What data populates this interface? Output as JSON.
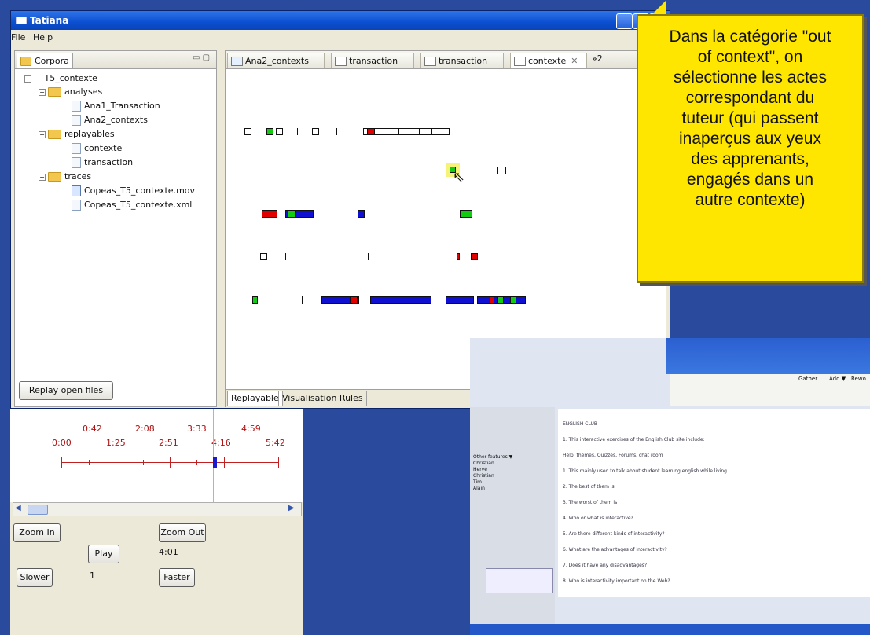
{
  "window": {
    "title": "Tatiana",
    "menu": [
      "File",
      "Help"
    ]
  },
  "left_panel": {
    "tab": "Corpora",
    "tree": {
      "root": "T5_contexte",
      "analyses": {
        "label": "analyses",
        "items": [
          "Ana1_Transaction",
          "Ana2_contexts"
        ]
      },
      "replayables": {
        "label": "replayables",
        "items": [
          "contexte",
          "transaction"
        ]
      },
      "traces": {
        "label": "traces",
        "items": [
          "Copeas_T5_contexte.mov",
          "Copeas_T5_contexte.xml"
        ]
      }
    },
    "replay_button": "Replay open files"
  },
  "right_panel": {
    "tabs": [
      "Ana2_contexts",
      "transaction",
      "transaction",
      "contexte"
    ],
    "overflow": "»2",
    "bottom_tabs": [
      "Replayable",
      "Visualisation Rules"
    ]
  },
  "callout": {
    "lines": [
      "Dans la catégorie \"out",
      "of context\", on",
      "sélectionne les actes",
      "correspondant du",
      "tuteur (qui passent",
      "inaperçus aux yeux",
      "des apprenants,",
      "engagés dans un",
      "autre contexte)"
    ]
  },
  "timeline": {
    "top_labels": [
      "0:42",
      "2:08",
      "3:33",
      "4:59"
    ],
    "bottom_labels": [
      "0:00",
      "1:25",
      "2:51",
      "4:16",
      "5:42"
    ],
    "current_time": "4:01",
    "speed": "1",
    "buttons": {
      "zoom_in": "Zoom In",
      "zoom_out": "Zoom Out",
      "play": "Play",
      "slower": "Slower",
      "faster": "Faster"
    }
  },
  "embedded": {
    "left_labels": [
      "Other features ▼",
      "Christian",
      "Hervé",
      "Christian",
      "Tim",
      "Alain"
    ],
    "buttons": [
      "Gather",
      "Add ▼",
      "Rewo"
    ],
    "lines": [
      "ENGLISH CLUB",
      "1. This interactive exercises of the English Club site include:",
      "Help, themes, Quizzes, Forums, chat room",
      "1. This mainly used to talk about student learning english while living",
      "2. The best of them is",
      "3. The worst of them is",
      "4. Who or what is interactive?",
      "5. Are there different kinds of interactivity?",
      "6. What are the advantages of interactivity?",
      "7. Does it have any disadvantages?",
      "8. Who is interactivity important on the Web?"
    ]
  }
}
